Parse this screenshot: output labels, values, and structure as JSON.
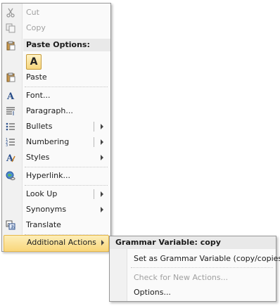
{
  "menu": {
    "cut": "Cut",
    "copy": "Copy",
    "paste_options_header": "Paste Options:",
    "paste_keep_text": "A",
    "paste": "Paste",
    "font": "Font...",
    "paragraph": "Paragraph...",
    "bullets": "Bullets",
    "numbering": "Numbering",
    "styles": "Styles",
    "hyperlink": "Hyperlink...",
    "look_up": "Look Up",
    "synonyms": "Synonyms",
    "translate": "Translate",
    "additional_actions": "Additional Actions"
  },
  "submenu": {
    "header": "Grammar Variable: copy",
    "set_variable": "Set as Grammar Variable (copy/copies)",
    "check_new": "Check for New Actions...",
    "options": "Options..."
  },
  "icons": {
    "cut": "scissors-icon",
    "copy": "copy-icon",
    "paste_options": "clipboard-icon",
    "paste": "clipboard-icon",
    "font": "font-a-icon",
    "paragraph": "paragraph-icon",
    "bullets": "bullets-icon",
    "numbering": "numbering-icon",
    "styles": "styles-icon",
    "hyperlink": "globe-link-icon",
    "translate": "translate-icon"
  },
  "colors": {
    "highlight_top": "#fdeeb8",
    "highlight_bottom": "#f9d67a",
    "disabled_text": "#a0a0a0",
    "gutter": "#f1f1f1"
  }
}
